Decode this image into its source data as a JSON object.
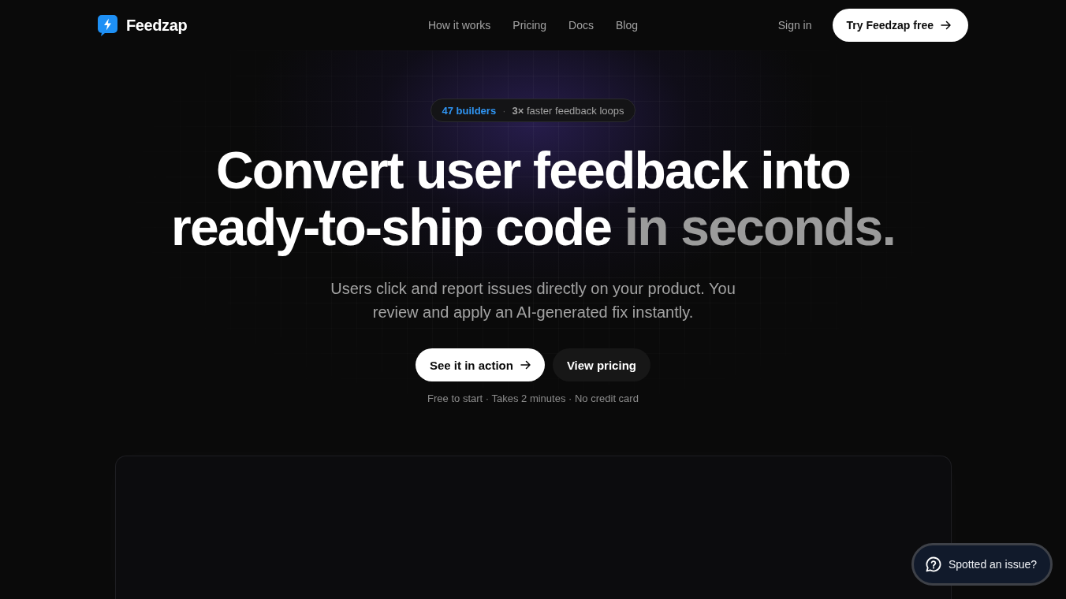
{
  "nav": {
    "brand": "Feedzap",
    "links": [
      {
        "label": "How it works"
      },
      {
        "label": "Pricing"
      },
      {
        "label": "Docs"
      },
      {
        "label": "Blog"
      }
    ],
    "sign_in": "Sign in",
    "cta": "Try Feedzap free"
  },
  "hero": {
    "badge": {
      "count": "47 builders",
      "separator": "·",
      "claim": "**3×** faster feedback loops"
    },
    "headline": [
      {
        "text": "Convert user feedback into ready-to-ship code",
        "muted": false
      },
      {
        "text": "in seconds.",
        "muted": true
      }
    ],
    "subtitle": "Users click and report issues directly on your product. You review and apply an AI-generated fix instantly.",
    "buttons": [
      {
        "label": "See it in action",
        "kind": "primary"
      },
      {
        "label": "View pricing",
        "kind": "secondary"
      }
    ],
    "footnote": "Free to start · Takes 2 minutes · No credit card"
  },
  "feedback_widget": {
    "label": "Spotted an issue?"
  }
}
